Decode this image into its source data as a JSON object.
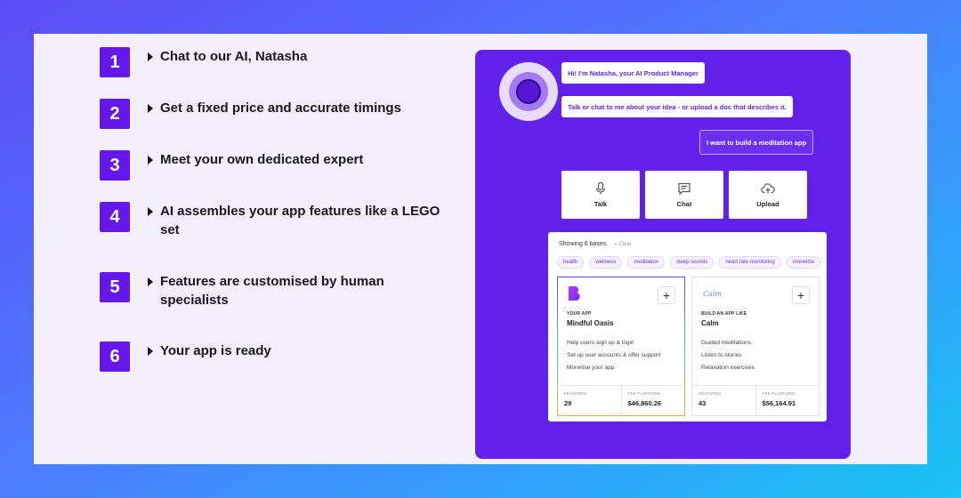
{
  "steps": [
    {
      "number": "1",
      "text": "Chat to our AI, Natasha"
    },
    {
      "number": "2",
      "text": "Get a fixed price and accurate timings"
    },
    {
      "number": "3",
      "text": "Meet your own dedicated expert"
    },
    {
      "number": "4",
      "text": "AI assembles your app features like a LEGO set"
    },
    {
      "number": "5",
      "text": "Features are customised by human specialists"
    },
    {
      "number": "6",
      "text": "Your app is ready"
    }
  ],
  "chat": {
    "bot_messages": [
      "Hi! I'm Natasha, your AI Product Manager",
      "Talk or chat to me about your idea - or upload a doc that describes it."
    ],
    "user_message": "I want to build a meditation app"
  },
  "actions": [
    {
      "label": "Talk",
      "icon": "microphone-icon"
    },
    {
      "label": "Chat",
      "icon": "chat-icon"
    },
    {
      "label": "Upload",
      "icon": "cloud-upload-icon"
    }
  ],
  "results": {
    "showing": "Showing 6 bases",
    "clear": "Clear",
    "tags": [
      "health",
      "wellness",
      "meditation",
      "sleep sounds",
      "heart rate monitoring",
      "monetize"
    ],
    "cards": [
      {
        "kicker": "YOUR APP",
        "name": "Mindful Oasis",
        "logo": "B",
        "features": [
          "Help users sign up & login",
          "Set up user accounts & offer support",
          "Monetise your app"
        ],
        "features_label": "FEATURES",
        "features_value": "29",
        "price_label": "FEE PLATFORM",
        "price_value": "$46,860.26"
      },
      {
        "kicker": "BUILD AN APP LIKE",
        "name": "Calm",
        "logo": "Calm",
        "features": [
          "Guided meditations",
          "Listen to stories",
          "Relaxation exercises"
        ],
        "features_label": "FEATURES",
        "features_value": "43",
        "price_label": "FEE PLATFORM",
        "price_value": "$56,164.91"
      }
    ]
  },
  "colors": {
    "accent": "#6418ea",
    "demo_bg": "#6221ea",
    "panel_bg": "#f2eefc"
  }
}
